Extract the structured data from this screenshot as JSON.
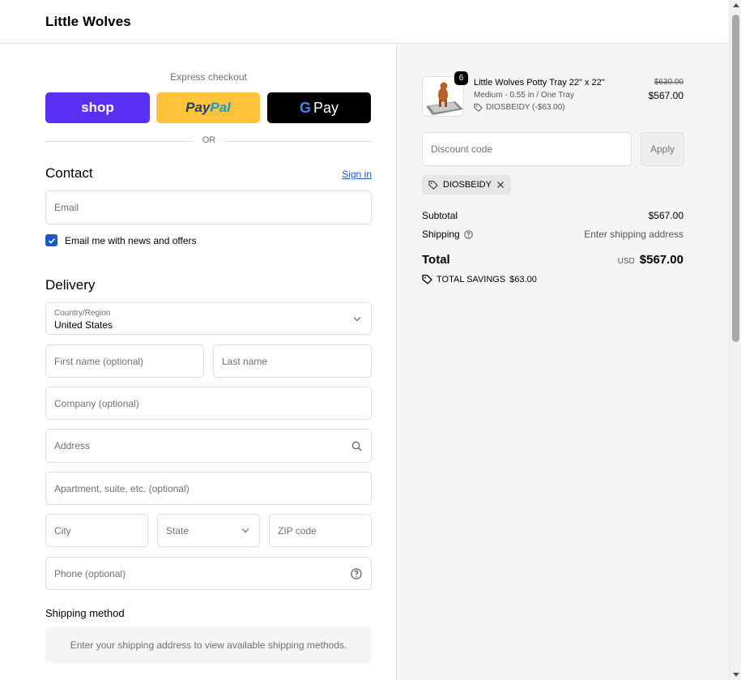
{
  "header": {
    "brand": "Little Wolves"
  },
  "express": {
    "title": "Express checkout",
    "shop_label": "shop",
    "paypal_label_1": "Pay",
    "paypal_label_2": "Pal",
    "gpay_g": "G",
    "gpay_label": "Pay",
    "or_label": "OR"
  },
  "contact": {
    "title": "Contact",
    "sign_in": "Sign in",
    "email_placeholder": "Email",
    "newsletter_label": "Email me with news and offers",
    "newsletter_checked": true
  },
  "delivery": {
    "title": "Delivery",
    "country_label": "Country/Region",
    "country_value": "United States",
    "first_name_placeholder": "First name (optional)",
    "last_name_placeholder": "Last name",
    "company_placeholder": "Company (optional)",
    "address_placeholder": "Address",
    "apartment_placeholder": "Apartment, suite, etc. (optional)",
    "city_placeholder": "City",
    "state_placeholder": "State",
    "zip_placeholder": "ZIP code",
    "phone_placeholder": "Phone (optional)"
  },
  "shipping_method": {
    "title": "Shipping method",
    "message": "Enter your shipping address to view available shipping methods."
  },
  "summary": {
    "item": {
      "quantity": "6",
      "title": "Little Wolves Potty Tray 22\" x 22\"",
      "variant": "Medium - 0.55 in / One Tray",
      "discount": "DIOSBEIDY (-$63.00)",
      "price_original": "$630.00",
      "price_final": "$567.00"
    },
    "discount_placeholder": "Discount code",
    "apply_label": "Apply",
    "applied_code": "DIOSBEIDY",
    "subtotal_label": "Subtotal",
    "subtotal_value": "$567.00",
    "shipping_label": "Shipping",
    "shipping_value": "Enter shipping address",
    "total_label": "Total",
    "total_currency": "USD",
    "total_value": "$567.00",
    "savings_label": "TOTAL SAVINGS",
    "savings_value": "$63.00"
  },
  "colors": {
    "accent": "#1f57c2",
    "shop_pay": "#5a31f4",
    "paypal": "#ffc439",
    "gpay": "#000000"
  }
}
